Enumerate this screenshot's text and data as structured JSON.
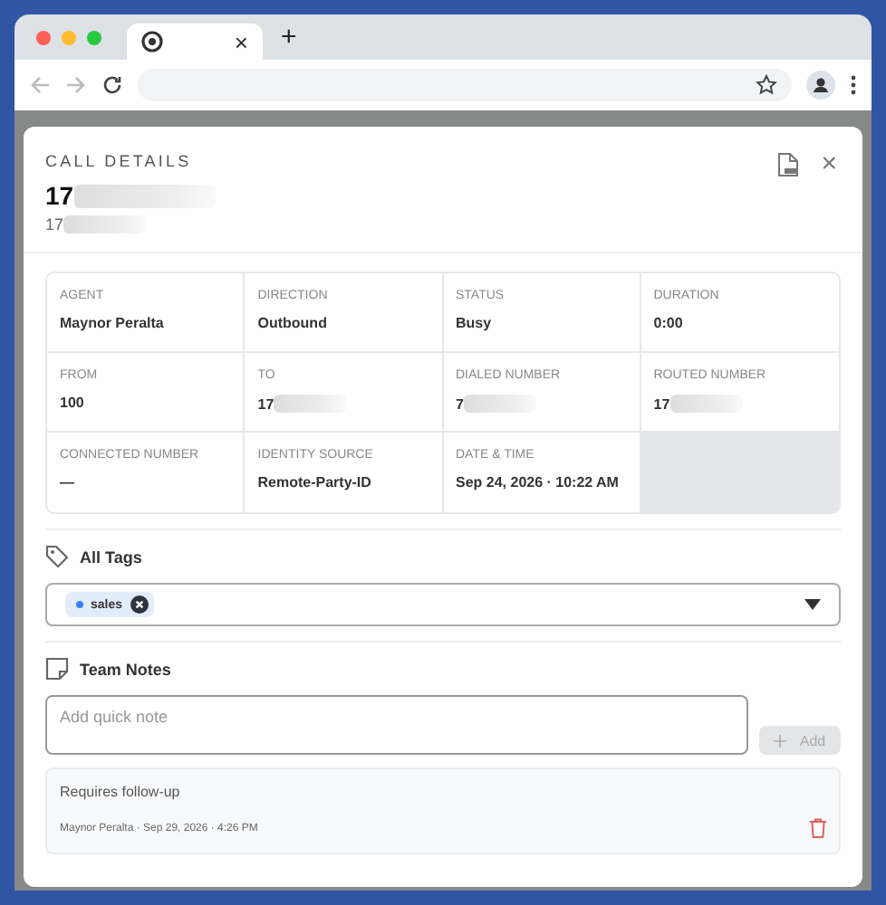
{
  "browser": {
    "tab_close": "×",
    "new_tab": "+"
  },
  "modal": {
    "heading": "CALL DETAILS",
    "title": "17",
    "subtitle": "17",
    "close": "×"
  },
  "details": [
    {
      "label": "AGENT",
      "value": "Maynor Peralta",
      "blurred": false
    },
    {
      "label": "DIRECTION",
      "value": "Outbound",
      "blurred": false
    },
    {
      "label": "STATUS",
      "value": "Busy",
      "blurred": false
    },
    {
      "label": "DURATION",
      "value": "0:00",
      "blurred": false
    },
    {
      "label": "FROM",
      "value": "100",
      "blurred": false
    },
    {
      "label": "TO",
      "value": "17",
      "blurred": true
    },
    {
      "label": "DIALED NUMBER",
      "value": "7",
      "blurred": true
    },
    {
      "label": "ROUTED NUMBER",
      "value": "17",
      "blurred": true
    },
    {
      "label": "CONNECTED NUMBER",
      "value": "—",
      "blurred": false
    },
    {
      "label": "IDENTITY SOURCE",
      "value": "Remote-Party-ID",
      "blurred": false
    },
    {
      "label": "DATE & TIME",
      "value": "Sep 24, 2026 · 10:22 AM",
      "blurred": false
    }
  ],
  "tags": {
    "title": "All Tags",
    "items": [
      {
        "label": "sales",
        "color": "#3b82f6"
      }
    ]
  },
  "notes": {
    "title": "Team Notes",
    "placeholder": "Add quick note",
    "add_button": {
      "label": "Add",
      "disabled": true
    },
    "items": [
      {
        "text": "Requires follow-up",
        "meta": "Maynor Peralta · Sep 29, 2026 · 4:26 PM"
      }
    ]
  }
}
